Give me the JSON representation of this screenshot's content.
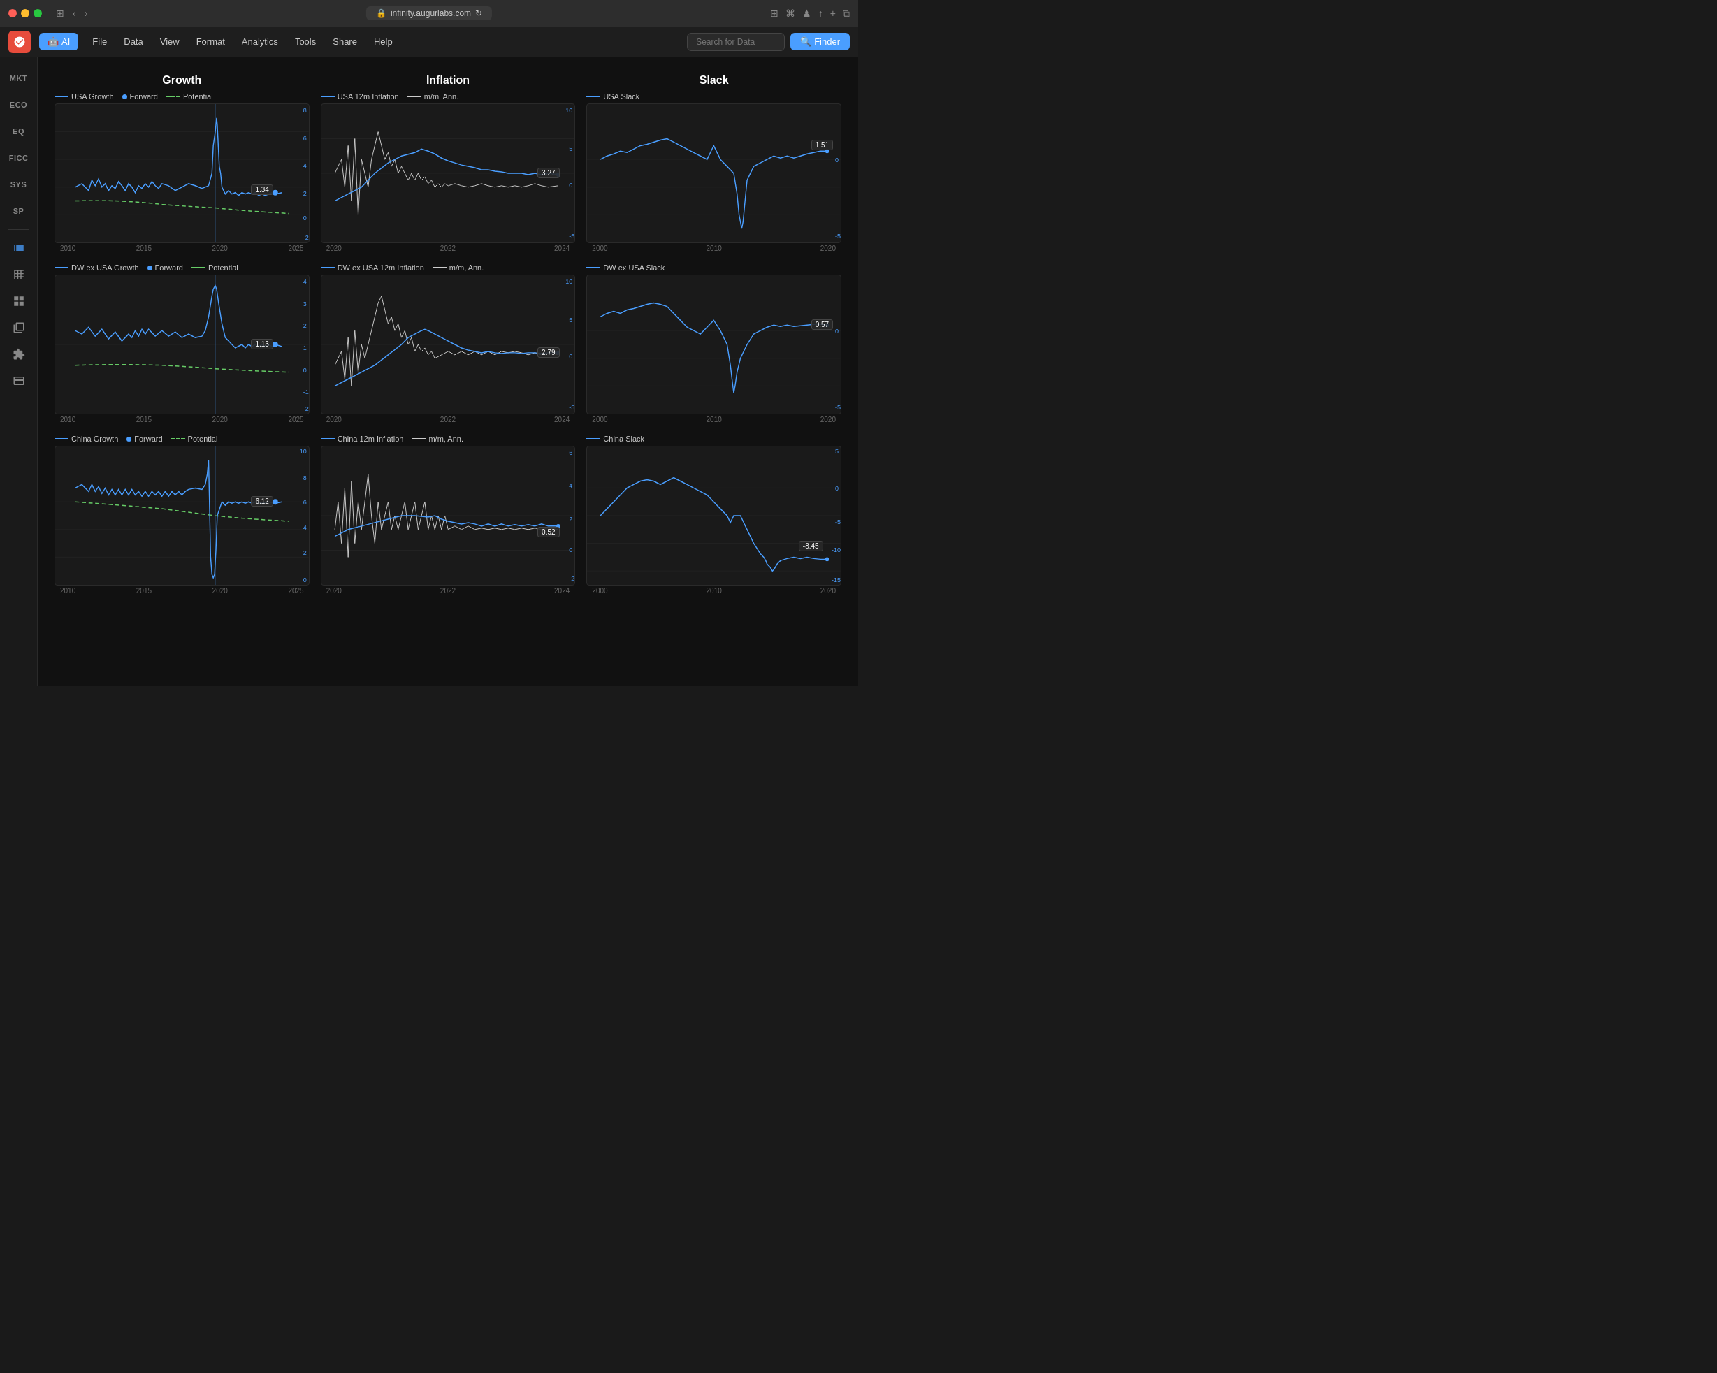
{
  "titleBar": {
    "url": "infinity.augurlabs.com"
  },
  "menuBar": {
    "logoIcon": "flame-icon",
    "aiLabel": "AI",
    "items": [
      "File",
      "Data",
      "View",
      "Format",
      "Analytics",
      "Tools",
      "Share",
      "Help"
    ],
    "searchPlaceholder": "Search for Data",
    "finderLabel": "Finder"
  },
  "sidebar": {
    "items": [
      {
        "label": "MKT",
        "id": "mkt"
      },
      {
        "label": "ECO",
        "id": "eco"
      },
      {
        "label": "EQ",
        "id": "eq"
      },
      {
        "label": "FICC",
        "id": "ficc"
      },
      {
        "label": "SYS",
        "id": "sys"
      },
      {
        "label": "SP",
        "id": "sp"
      }
    ],
    "icons": [
      {
        "name": "chart-line-icon"
      },
      {
        "name": "table-icon"
      },
      {
        "name": "dashboard-icon"
      },
      {
        "name": "library-icon"
      },
      {
        "name": "plugin-icon"
      },
      {
        "name": "card-icon"
      }
    ]
  },
  "charts": {
    "rows": [
      {
        "sections": [
          {
            "title": "Growth",
            "legend": [
              {
                "type": "line",
                "color": "blue",
                "label": "USA Growth"
              },
              {
                "type": "dot",
                "label": "Forward"
              },
              {
                "type": "dash",
                "color": "green",
                "label": "Potential"
              }
            ],
            "yAxisRight": [
              "8",
              "6",
              "4",
              "2",
              "0",
              "-2"
            ],
            "xAxis": [
              "2010",
              "2015",
              "2020",
              "2025"
            ],
            "valueLabel": "1.34",
            "valueLabelPos": {
              "right": "18%",
              "top": "55%"
            }
          },
          {
            "title": "Inflation",
            "legend": [
              {
                "type": "line",
                "color": "blue",
                "label": "USA 12m Inflation"
              },
              {
                "type": "line",
                "color": "white",
                "label": "m/m, Ann."
              }
            ],
            "yAxisRight": [
              "10",
              "5",
              "0",
              "-5"
            ],
            "xAxis": [
              "2020",
              "2022",
              "2024"
            ],
            "valueLabel": "3.27",
            "valueLabelPos": {
              "right": "8%",
              "top": "48%"
            }
          },
          {
            "title": "Slack",
            "legend": [
              {
                "type": "line",
                "color": "blue",
                "label": "USA Slack"
              }
            ],
            "yAxisRight": [
              "0",
              "-5"
            ],
            "xAxis": [
              "2000",
              "2010",
              "2020"
            ],
            "valueLabel": "1.51",
            "valueLabelPos": {
              "right": "4%",
              "top": "28%"
            }
          }
        ]
      },
      {
        "sections": [
          {
            "title": "",
            "legend": [
              {
                "type": "line",
                "color": "blue",
                "label": "DW ex USA Growth"
              },
              {
                "type": "dot",
                "label": "Forward"
              },
              {
                "type": "dash",
                "color": "green",
                "label": "Potential"
              }
            ],
            "yAxisRight": [
              "4",
              "3",
              "2",
              "1",
              "0",
              "-1",
              "-2"
            ],
            "xAxis": [
              "2010",
              "2015",
              "2020",
              "2025"
            ],
            "valueLabel": "1.13",
            "valueLabelPos": {
              "right": "18%",
              "top": "50%"
            }
          },
          {
            "title": "",
            "legend": [
              {
                "type": "line",
                "color": "blue",
                "label": "DW ex USA 12m Inflation"
              },
              {
                "type": "line",
                "color": "white",
                "label": "m/m, Ann."
              }
            ],
            "yAxisRight": [
              "10",
              "5",
              "0",
              "-5"
            ],
            "xAxis": [
              "2020",
              "2022",
              "2024"
            ],
            "valueLabel": "2.79",
            "valueLabelPos": {
              "right": "8%",
              "top": "55%"
            }
          },
          {
            "title": "",
            "legend": [
              {
                "type": "line",
                "color": "blue",
                "label": "DW ex USA Slack"
              }
            ],
            "yAxisRight": [
              "0",
              "-5"
            ],
            "xAxis": [
              "2000",
              "2010",
              "2020"
            ],
            "valueLabel": "0.57",
            "valueLabelPos": {
              "right": "4%",
              "top": "38%"
            }
          }
        ]
      },
      {
        "sections": [
          {
            "title": "",
            "legend": [
              {
                "type": "line",
                "color": "blue",
                "label": "China Growth"
              },
              {
                "type": "dot",
                "label": "Forward"
              },
              {
                "type": "dash",
                "color": "green",
                "label": "Potential"
              }
            ],
            "yAxisRight": [
              "10",
              "8",
              "6",
              "4",
              "2",
              "0"
            ],
            "xAxis": [
              "2010",
              "2015",
              "2020",
              "2025"
            ],
            "valueLabel": "6.12",
            "valueLabelPos": {
              "right": "18%",
              "top": "42%"
            }
          },
          {
            "title": "",
            "legend": [
              {
                "type": "line",
                "color": "blue",
                "label": "China 12m Inflation"
              },
              {
                "type": "line",
                "color": "white",
                "label": "m/m, Ann."
              }
            ],
            "yAxisRight": [
              "6",
              "4",
              "2",
              "0",
              "-2"
            ],
            "xAxis": [
              "2020",
              "2022",
              "2024"
            ],
            "valueLabel": "0.52",
            "valueLabelPos": {
              "right": "8%",
              "top": "60%"
            }
          },
          {
            "title": "",
            "legend": [
              {
                "type": "line",
                "color": "blue",
                "label": "China Slack"
              }
            ],
            "yAxisRight": [
              "5",
              "0",
              "-5",
              "-10",
              "-15"
            ],
            "xAxis": [
              "2000",
              "2010",
              "2020"
            ],
            "valueLabel": "-8.45",
            "valueLabelPos": {
              "right": "10%",
              "top": "72%"
            }
          }
        ]
      }
    ]
  }
}
